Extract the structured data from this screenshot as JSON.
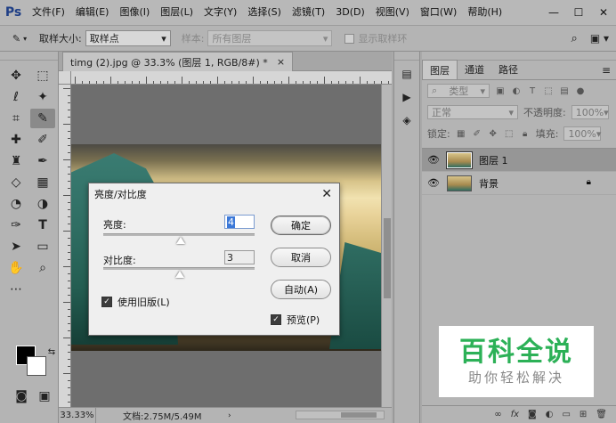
{
  "app": {
    "logo": "Ps"
  },
  "menu": [
    "文件(F)",
    "编辑(E)",
    "图像(I)",
    "图层(L)",
    "文字(Y)",
    "选择(S)",
    "滤镜(T)",
    "3D(D)",
    "视图(V)",
    "窗口(W)",
    "帮助(H)"
  ],
  "window_controls": {
    "minimize": "—",
    "maximize": "☐",
    "close": "✕"
  },
  "options_bar": {
    "sample_size_label": "取样大小:",
    "sample_size_value": "取样点",
    "sample_label": "样本:",
    "sample_value": "所有图层",
    "show_ring_label": "显示取样环"
  },
  "document": {
    "tab_title": "timg (2).jpg @ 33.3% (图层 1, RGB/8#) *",
    "tab_close": "×",
    "zoom": "33.33%",
    "doc_info": "文档:2.75M/5.49M"
  },
  "dialog": {
    "title": "亮度/对比度",
    "close": "✕",
    "brightness_label": "亮度:",
    "brightness_value": "4",
    "brightness_pos": 0.51,
    "contrast_label": "对比度:",
    "contrast_value": "3",
    "contrast_pos": 0.505,
    "legacy_label": "使用旧版(L)",
    "legacy_checked": true,
    "ok_label": "确定",
    "cancel_label": "取消",
    "auto_label": "自动(A)",
    "preview_label": "预览(P)",
    "preview_checked": true
  },
  "layers_panel": {
    "tabs": [
      "图层",
      "通道",
      "路径"
    ],
    "active_tab": 0,
    "kind_filter": "类型",
    "blend_mode": "正常",
    "opacity_label": "不透明度:",
    "opacity_value": "100%",
    "lock_label": "锁定:",
    "fill_label": "填充:",
    "fill_value": "100%",
    "layers": [
      {
        "name": "图层 1",
        "selected": true,
        "locked": false
      },
      {
        "name": "背景",
        "selected": false,
        "locked": true
      }
    ]
  },
  "watermark": {
    "title": "百科全说",
    "subtitle": "助你轻松解决"
  },
  "colors": {
    "accent": "#3b78d8",
    "watermark_green": "#2cb157"
  }
}
